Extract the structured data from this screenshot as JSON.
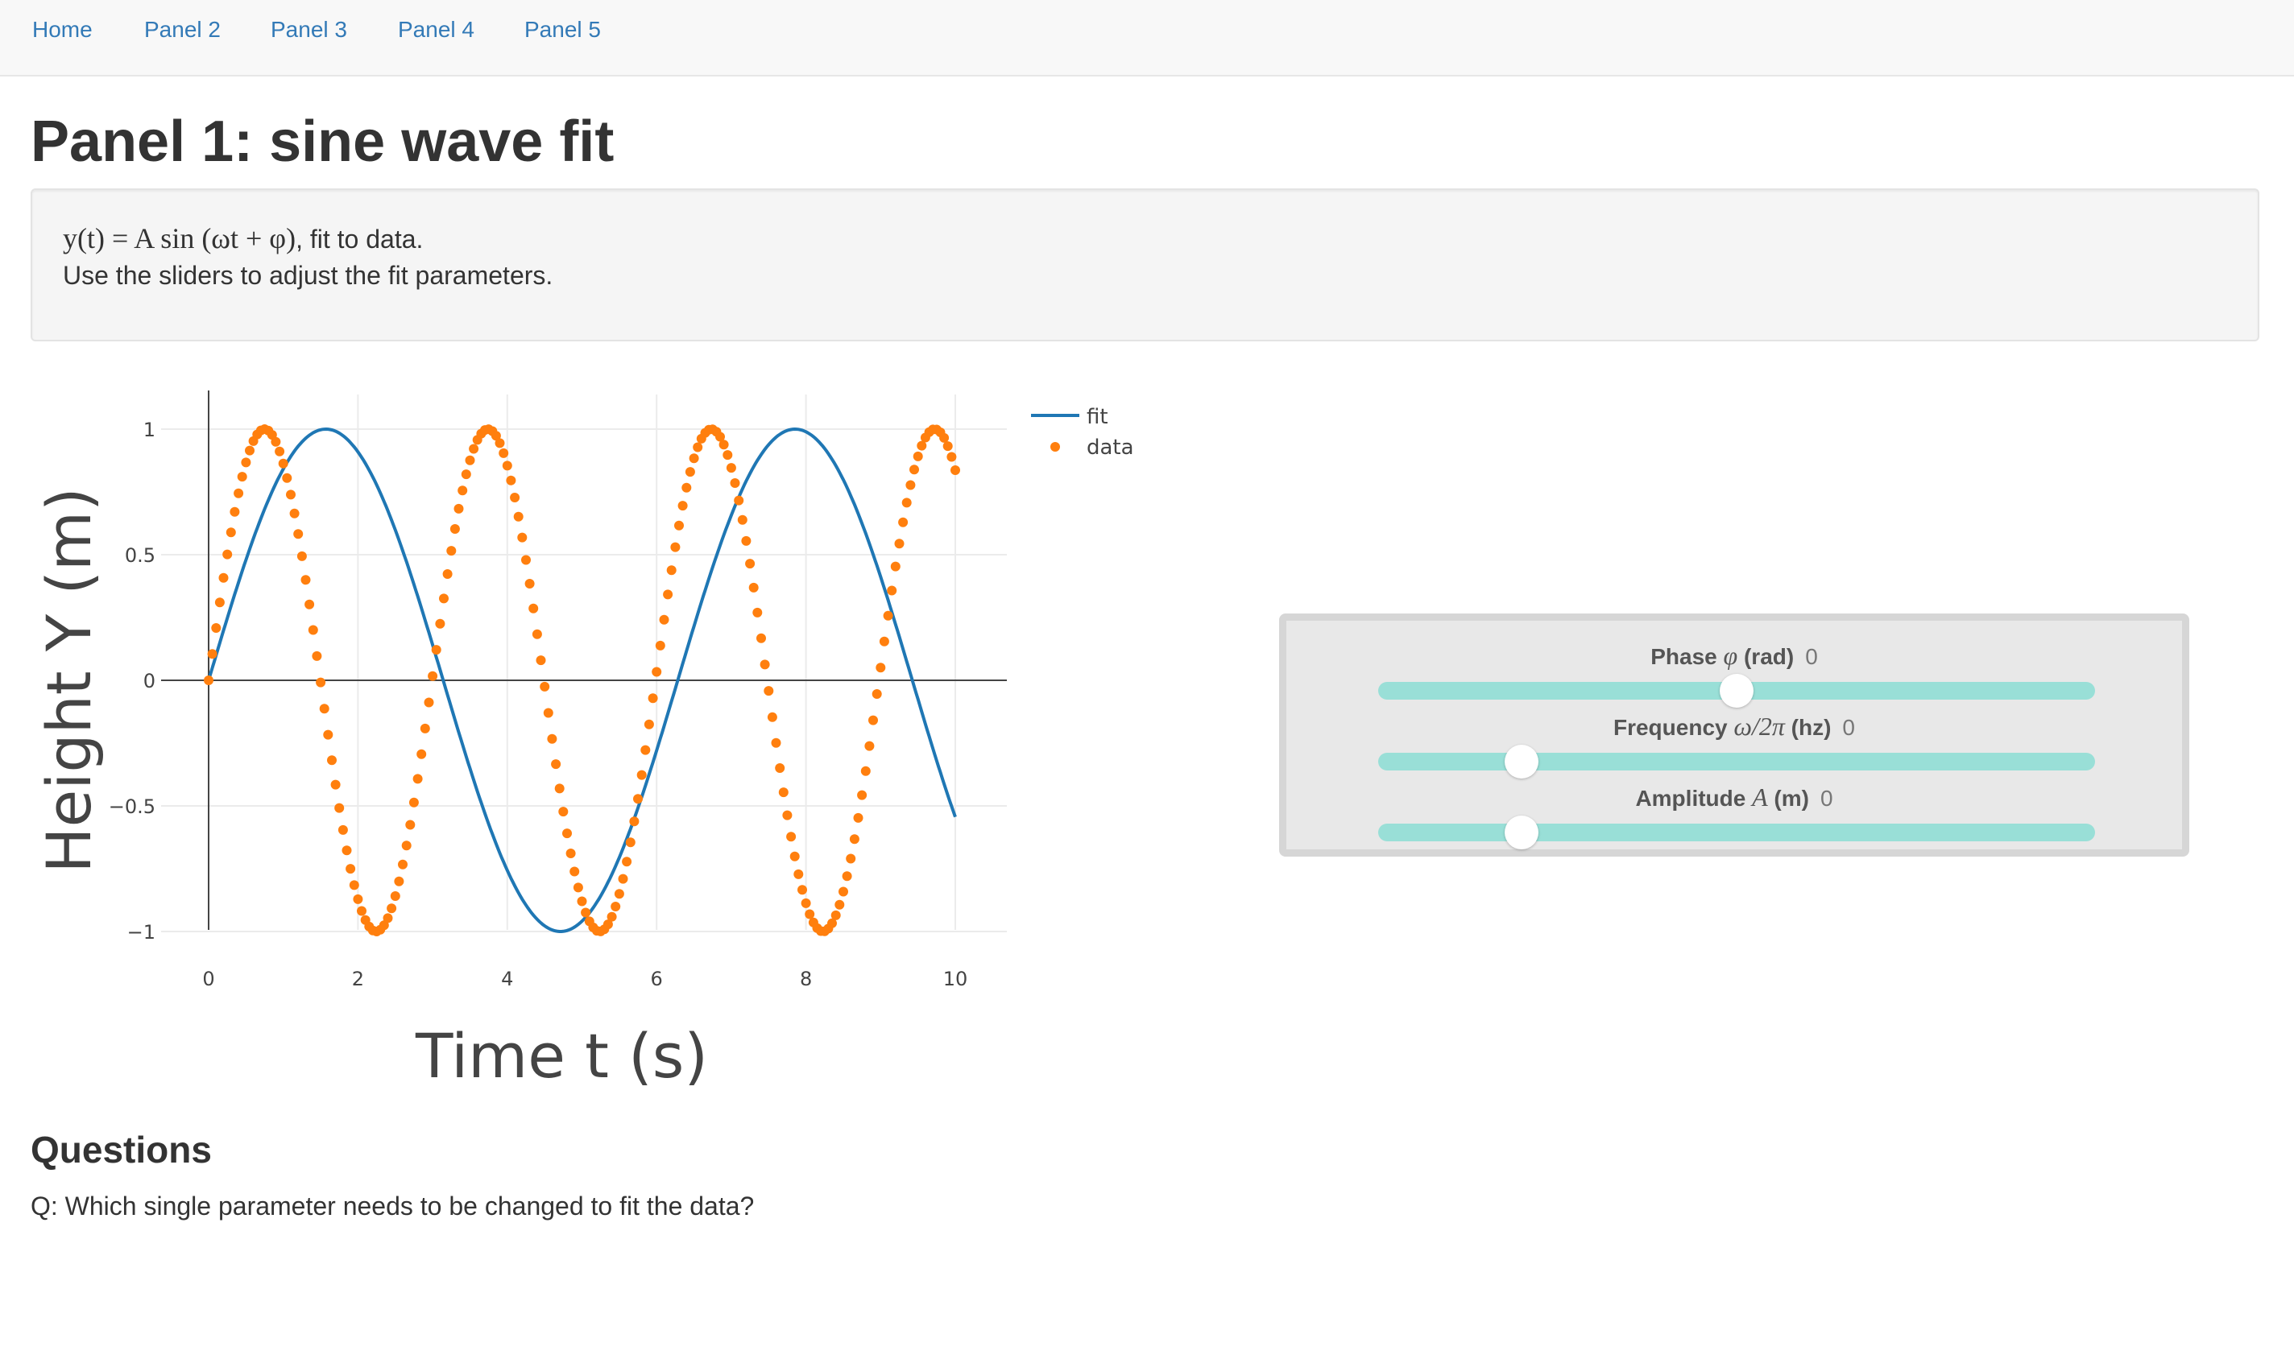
{
  "nav": {
    "items": [
      "Home",
      "Panel 2",
      "Panel 3",
      "Panel 4",
      "Panel 5"
    ]
  },
  "page": {
    "title": "Panel 1: sine wave fit"
  },
  "intro": {
    "equation_prefix": "y(t) = A sin (ωt + φ)",
    "equation_suffix": ", fit to data.",
    "instruction": "Use the sliders to adjust the fit parameters."
  },
  "chart_data": {
    "type": "scatter",
    "xlabel": "Time t (s)",
    "ylabel": "Height Y (m)",
    "xlim": [
      0,
      10.5
    ],
    "ylim": [
      -1.1,
      1.1
    ],
    "x_ticks": [
      0,
      2,
      4,
      6,
      8,
      10
    ],
    "y_ticks": [
      1,
      0.5,
      0,
      -0.5,
      -1
    ],
    "y_tick_labels": [
      "1",
      "0.5",
      "0",
      "−0.5",
      "−1"
    ],
    "grid": true,
    "legend_position": "top-right",
    "series": [
      {
        "name": "fit",
        "mode": "line",
        "color": "#1f77b4",
        "function": "sin(t)",
        "x_range": [
          0,
          10
        ],
        "y_at_x_end": -0.54
      },
      {
        "name": "data",
        "mode": "markers",
        "color": "#ff7f0e",
        "function": "sin(2.1 t)",
        "x_range": [
          0,
          10
        ],
        "n_points": 201,
        "peaks_at_x": [
          0.75,
          3.6,
          6.4,
          9.3
        ],
        "troughs_at_x": [
          2.2,
          5.0,
          7.8
        ]
      }
    ]
  },
  "sliders": [
    {
      "label_pre": "Phase ",
      "label_math": "φ",
      "label_post": " (rad)",
      "value": "0",
      "fraction": 0.5
    },
    {
      "label_pre": "Frequency ",
      "label_math": "ω/2π",
      "label_post": " (hz)",
      "value": "0",
      "fraction": 0.2
    },
    {
      "label_pre": "Amplitude ",
      "label_math": "A",
      "label_post": " (m)",
      "value": "0",
      "fraction": 0.2
    }
  ],
  "questions": {
    "heading": "Questions",
    "q1": "Q: Which single parameter needs to be changed to fit the data?"
  },
  "colors": {
    "link": "#337ab7",
    "fit_line": "#1f77b4",
    "data_markers": "#ff7f0e",
    "slider_track": "#99dfd7"
  }
}
